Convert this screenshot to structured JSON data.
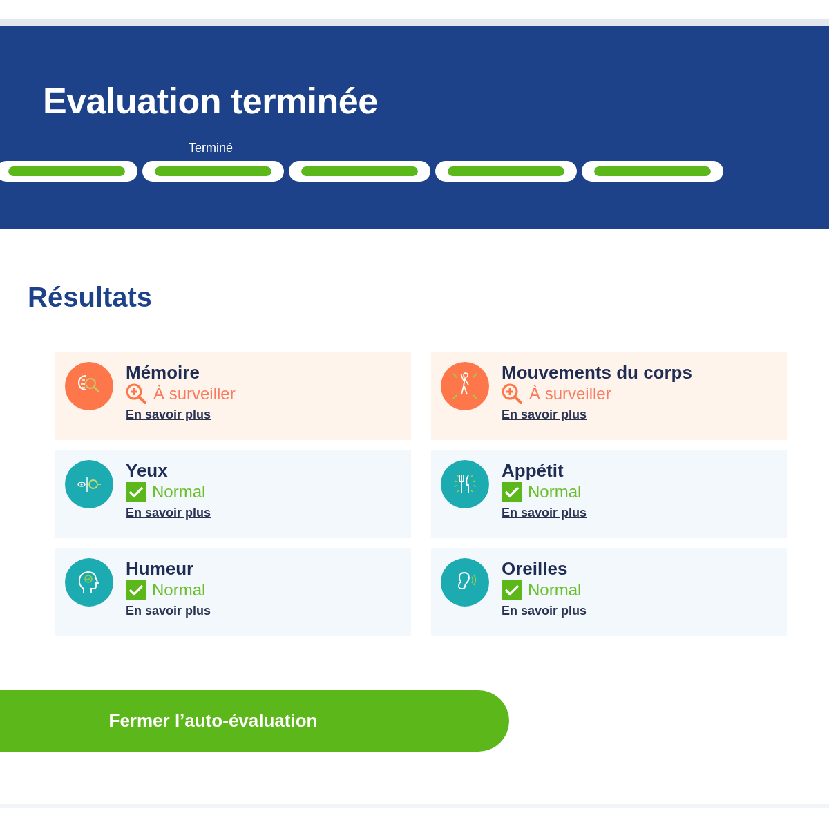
{
  "header": {
    "title": "Evaluation terminée",
    "progress": {
      "label": "Terminé",
      "steps": [
        {
          "level": 1
        },
        {
          "level": 1
        },
        {
          "level": 1
        },
        {
          "level": 1
        },
        {
          "level": 1
        }
      ]
    }
  },
  "results": {
    "heading": "Résultats",
    "items": [
      {
        "title": "Mémoire",
        "status": {
          "kind": "watch",
          "label": "À surveiller"
        },
        "link": "En savoir plus"
      },
      {
        "title": "Mouvements du corps",
        "status": {
          "kind": "watch",
          "label": "À surveiller"
        },
        "link": "En savoir plus"
      },
      {
        "title": "Yeux",
        "status": {
          "kind": "normal",
          "label": "Normal"
        },
        "link": "En savoir plus"
      },
      {
        "title": "Appétit",
        "status": {
          "kind": "normal",
          "label": "Normal"
        },
        "link": "En savoir plus"
      },
      {
        "title": "Humeur",
        "status": {
          "kind": "normal",
          "label": "Normal"
        },
        "link": "En savoir plus"
      },
      {
        "title": "Oreilles",
        "status": {
          "kind": "normal",
          "label": "Normal"
        },
        "link": "En savoir plus"
      }
    ]
  },
  "close_button": "Fermer l’auto-évaluation"
}
